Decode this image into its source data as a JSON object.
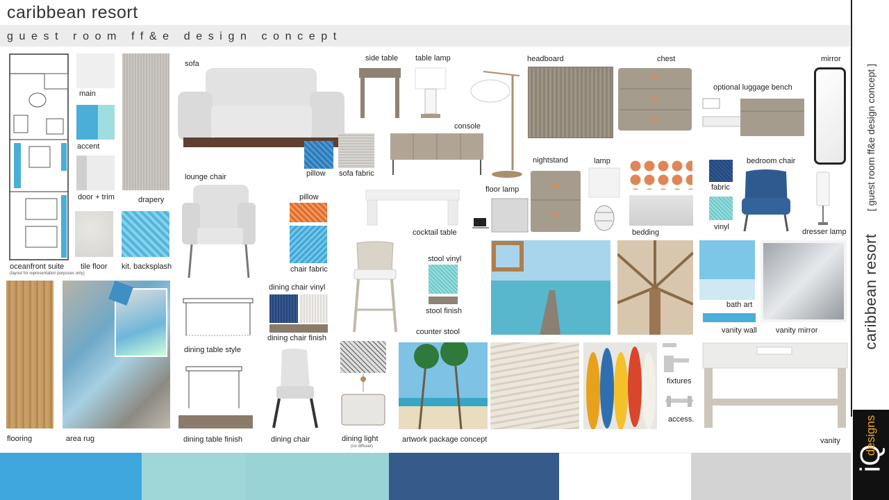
{
  "header": {
    "title": "caribbean resort",
    "subtitle": "guest room ff&e design concept"
  },
  "sidebar": {
    "title": "caribbean resort",
    "subtitle": "[ guest room ff&e design concept ]"
  },
  "logo": {
    "mark": "iQ",
    "word": "designs"
  },
  "labels": {
    "main": "main",
    "accent": "accent",
    "door_trim": "door + trim",
    "drapery": "drapery",
    "oceanfront_suite": "oceanfront suite",
    "suite_note": "(layout for representation purposes only)",
    "tile_floor": "tile floor",
    "kit_backsplash": "kit. backsplash",
    "sofa": "sofa",
    "pillow1": "pillow",
    "sofa_fabric": "sofa fabric",
    "lounge_chair": "lounge chair",
    "pillow2": "pillow",
    "chair_fabric": "chair fabric",
    "dining_chair_vinyl": "dining chair vinyl",
    "dining_chair_finish": "dining chair finish",
    "side_table": "side table",
    "table_lamp": "table lamp",
    "console": "console",
    "floor_lamp": "floor lamp",
    "cocktail_table": "cocktail table",
    "stool_vinyl": "stool vinyl",
    "stool_finish": "stool finish",
    "counter_stool": "counter stool",
    "headboard": "headboard",
    "chest": "chest",
    "nightstand": "nightstand",
    "lamp": "lamp",
    "bedding": "bedding",
    "optional_luggage_bench": "optional luggage bench",
    "mirror": "mirror",
    "fabric": "fabric",
    "vinyl": "vinyl",
    "bedroom_chair": "bedroom chair",
    "dresser_lamp": "dresser lamp",
    "bath_art": "bath art",
    "vanity_wall": "vanity wall",
    "vanity_mirror": "vanity mirror",
    "flooring": "flooring",
    "area_rug": "area rug",
    "dining_table_style": "dining table style",
    "dining_table_finish": "dining table finish",
    "dining_chair": "dining chair",
    "dining_light": "dining light",
    "dining_light_note": "(no diffuser)",
    "artwork_package": "artwork package concept",
    "fixtures": "fixtures",
    "access": "access.",
    "vanity": "vanity"
  },
  "palette": {
    "main": "#efefef",
    "accent_1": "#4aaed8",
    "accent_2": "#a0dde0",
    "door_trim": "#cfcfcf",
    "door_trim_light": "#ececec"
  },
  "strip": [
    "#3ea6dc",
    "#9fd6d8",
    "#9ad3d6",
    "#355b8b",
    "#ffffff",
    "#d3d3d3"
  ]
}
